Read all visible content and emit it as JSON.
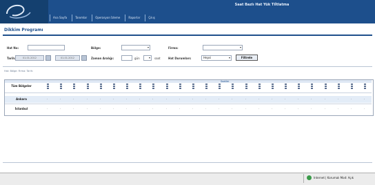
{
  "header": {
    "title": "Saat Bazlı Hat Yük Tiİtlatma",
    "nav": [
      "Ana Sayfa",
      "Tanımlar",
      "Operasyon İzleme",
      "Raporlar",
      "Çıkış"
    ]
  },
  "page": {
    "title": "Dikkim Programı"
  },
  "filters": {
    "row1": {
      "hat_label": "Hat No:",
      "bolge_label": "Bölge:",
      "firma_label": "Firma:"
    },
    "row2": {
      "tarih_label": "Tarih:",
      "date_from": "01.01.2012",
      "date_to": "01.01.2012",
      "zaman_label": "Zaman Aralığı:",
      "gun_label": "gün",
      "saat_label": "saat",
      "hat_durumlari_label": "Hat Durumları:",
      "hat_durumlari_value": "Hepsi",
      "filter_button": "Filtrele"
    }
  },
  "summary": "Hat: Bölge: Firma: Tarih:",
  "table": {
    "group_label": "Saatler",
    "row_header": "Tüm Bölgeler",
    "rows": [
      "Ankara",
      "İstanbul"
    ],
    "column_count": 25,
    "cell_value": "-"
  },
  "statusbar": {
    "text": "Internet | Korumalı Mod: Açık"
  },
  "colors": {
    "header": "#1d4f8c",
    "row_highlight": "#e3ecf7"
  }
}
